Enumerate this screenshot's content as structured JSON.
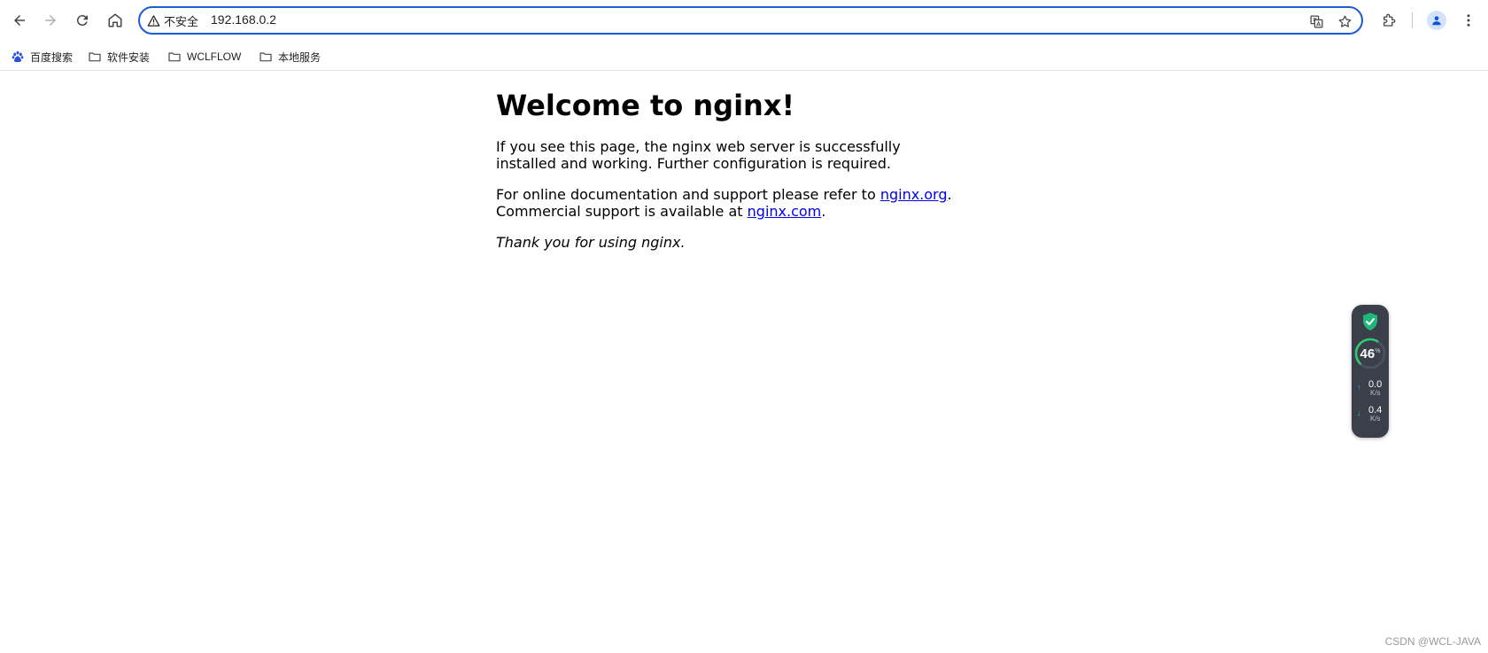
{
  "browser": {
    "security_label": "不安全",
    "url": "192.168.0.2",
    "bookmarks": [
      {
        "label": "百度搜索",
        "icon": "baidu-paw-icon"
      },
      {
        "label": "软件安装",
        "icon": "folder-icon"
      },
      {
        "label": "WCLFLOW",
        "icon": "folder-icon"
      },
      {
        "label": "本地服务",
        "icon": "folder-icon"
      }
    ]
  },
  "page": {
    "heading": "Welcome to nginx!",
    "para1": "If you see this page, the nginx web server is successfully installed and working. Further configuration is required.",
    "para2_prefix": "For online documentation and support please refer to ",
    "link_org": "nginx.org",
    "para2_mid": ". Commercial support is available at ",
    "link_com": "nginx.com",
    "para2_suffix": ".",
    "thanks": "Thank you for using nginx."
  },
  "widget": {
    "percent": "46",
    "percent_unit": "%",
    "percent_value": 0.46,
    "upload": "0.0",
    "download": "0.4",
    "unit": "K/s",
    "accent_color": "#2ecc71"
  },
  "watermark": "CSDN @WCL-JAVA"
}
